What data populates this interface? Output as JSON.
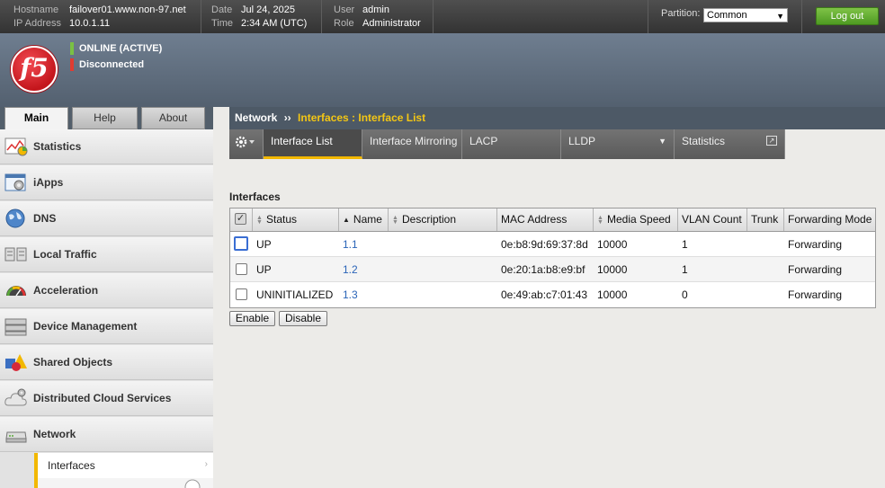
{
  "topbar": {
    "hostname_label": "Hostname",
    "hostname": "failover01.www.non-97.net",
    "ip_label": "IP Address",
    "ip": "10.0.1.11",
    "date_label": "Date",
    "date": "Jul 24, 2025",
    "time_label": "Time",
    "time": "2:34 AM (UTC)",
    "user_label": "User",
    "user": "admin",
    "role_label": "Role",
    "role": "Administrator",
    "partition_label": "Partition:",
    "partition_value": "Common",
    "logout_label": "Log out"
  },
  "header": {
    "logo_text": "f5",
    "status_online": "ONLINE (ACTIVE)",
    "status_sync": "Disconnected",
    "online_color": "#7ac143",
    "sync_color": "#e03c31"
  },
  "main_tabs": [
    "Main",
    "Help",
    "About"
  ],
  "sidebar": {
    "items": [
      {
        "label": "Statistics",
        "icon": "statistics-chart-icon"
      },
      {
        "label": "iApps",
        "icon": "iapps-gear-window-icon"
      },
      {
        "label": "DNS",
        "icon": "globe-icon"
      },
      {
        "label": "Local Traffic",
        "icon": "servers-icon"
      },
      {
        "label": "Acceleration",
        "icon": "speedometer-icon"
      },
      {
        "label": "Device Management",
        "icon": "server-stack-icon"
      },
      {
        "label": "Shared Objects",
        "icon": "shapes-icon"
      },
      {
        "label": "Distributed Cloud Services",
        "icon": "cloud-gear-icon"
      },
      {
        "label": "Network",
        "icon": "network-device-icon"
      }
    ],
    "sub_items": [
      "Interfaces"
    ]
  },
  "breadcrumb": {
    "section": "Network",
    "separator": "››",
    "current": "Interfaces : Interface List"
  },
  "subtabs": [
    "Interface List",
    "Interface Mirroring",
    "LACP",
    "LLDP",
    "Statistics"
  ],
  "table": {
    "title": "Interfaces",
    "columns": [
      "Status",
      "Name",
      "Description",
      "MAC Address",
      "Media Speed",
      "VLAN Count",
      "Trunk",
      "Forwarding Mode"
    ],
    "rows": [
      {
        "status": "UP",
        "name": "1.1",
        "description": "",
        "mac": "0e:b8:9d:69:37:8d",
        "speed": "10000",
        "vlan_count": "1",
        "trunk": "",
        "mode": "Forwarding"
      },
      {
        "status": "UP",
        "name": "1.2",
        "description": "",
        "mac": "0e:20:1a:b8:e9:bf",
        "speed": "10000",
        "vlan_count": "1",
        "trunk": "",
        "mode": "Forwarding"
      },
      {
        "status": "UNINITIALIZED",
        "name": "1.3",
        "description": "",
        "mac": "0e:49:ab:c7:01:43",
        "speed": "10000",
        "vlan_count": "0",
        "trunk": "",
        "mode": "Forwarding"
      }
    ]
  },
  "buttons": {
    "enable": "Enable",
    "disable": "Disable"
  }
}
